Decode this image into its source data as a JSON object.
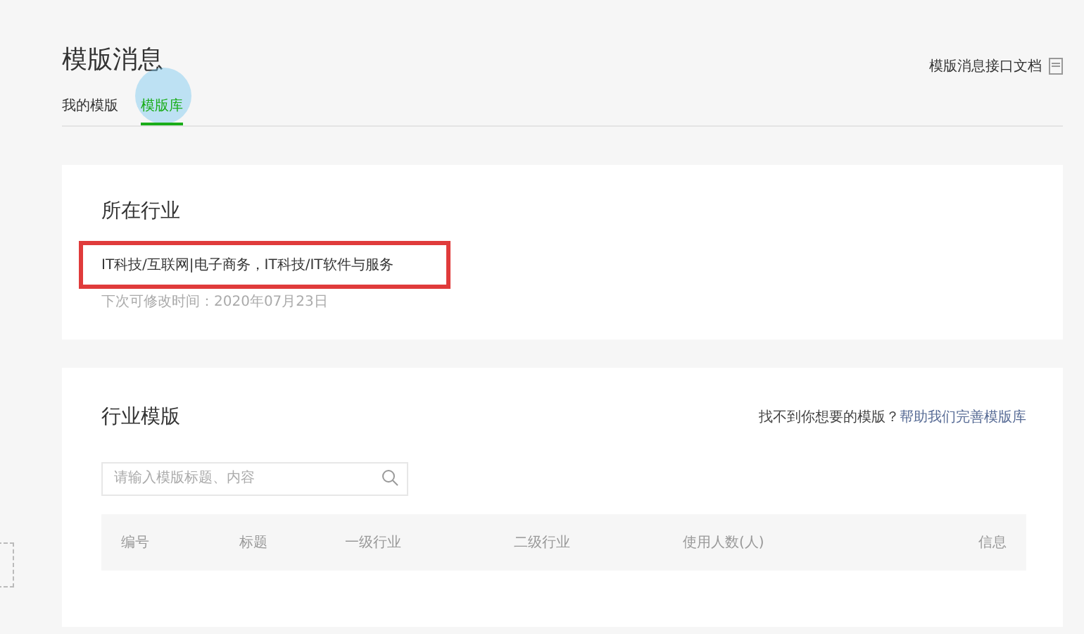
{
  "header": {
    "title": "模版消息",
    "doc_link": "模版消息接口文档"
  },
  "tabs": [
    {
      "label": "我的模版",
      "selected": false
    },
    {
      "label": "模版库",
      "selected": true
    }
  ],
  "industry_card": {
    "title": "所在行业",
    "industries": "IT科技/互联网|电子商务，IT科技/IT软件与服务",
    "next_change": "下次可修改时间：2020年07月23日",
    "highlighted": true
  },
  "templates_card": {
    "title": "行业模版",
    "hint": "找不到你想要的模版？",
    "help_link": "帮助我们完善模版库",
    "search": {
      "placeholder": "请输入模版标题、内容"
    },
    "columns": [
      "编号",
      "标题",
      "一级行业",
      "二级行业",
      "使用人数(人)",
      "信息"
    ]
  }
}
